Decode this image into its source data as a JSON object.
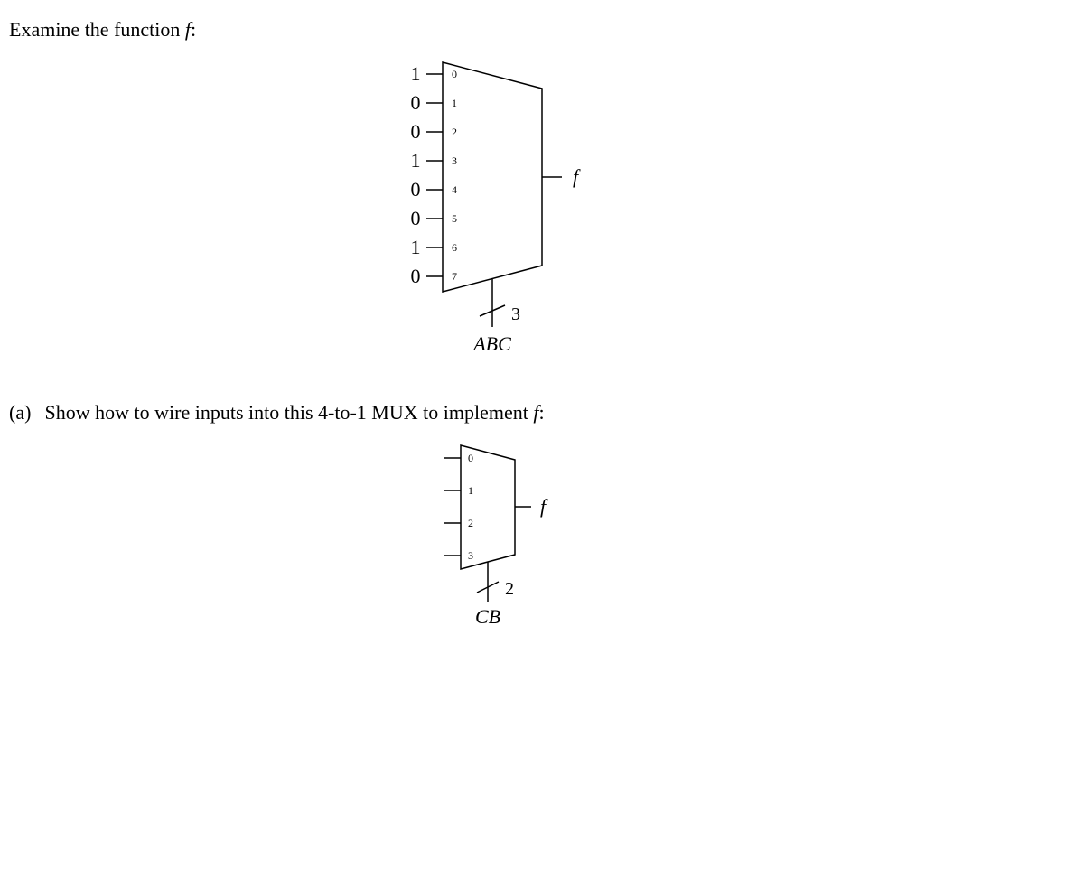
{
  "intro": {
    "prefix": "Examine the function ",
    "fvar": "f",
    "suffix": ":"
  },
  "mux8": {
    "inputs": [
      "1",
      "0",
      "0",
      "1",
      "0",
      "0",
      "1",
      "0"
    ],
    "ports": [
      "0",
      "1",
      "2",
      "3",
      "4",
      "5",
      "6",
      "7"
    ],
    "out_label": "f",
    "select_width": "3",
    "select_label": "ABC"
  },
  "partA": {
    "marker": "(a)",
    "text_prefix": "Show how to wire inputs into this 4-to-1 MUX to implement ",
    "fvar": "f",
    "text_suffix": ":"
  },
  "mux4": {
    "ports": [
      "0",
      "1",
      "2",
      "3"
    ],
    "out_label": "f",
    "select_width": "2",
    "select_label": "CB"
  }
}
